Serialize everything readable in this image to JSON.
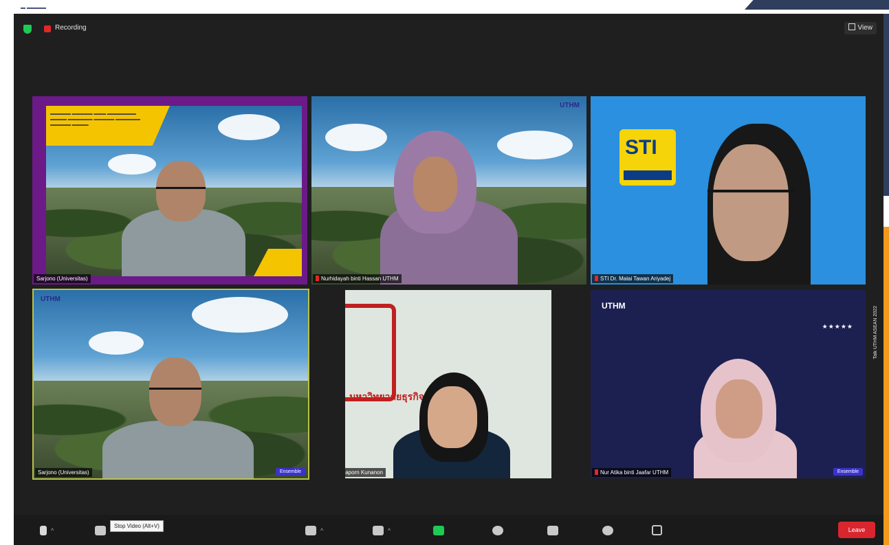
{
  "window": {
    "recording_label": "Recording",
    "view_label": "View"
  },
  "participants": [
    {
      "name": "Sarjono (Universitas)",
      "muted": false,
      "badge": ""
    },
    {
      "name": "Nurhidayah binti Hassan UTHM",
      "muted": true,
      "badge": ""
    },
    {
      "name": "STI Dr. Malai Tawan Ariyadej",
      "muted": true,
      "badge": ""
    },
    {
      "name": "Sarjono (Universitas)",
      "muted": false,
      "badge": "Ensemble"
    },
    {
      "name": "Thanaporn Kunanon",
      "muted": true,
      "badge": ""
    },
    {
      "name": "Nur Atika binti Jaafar UTHM",
      "muted": true,
      "badge": "Ensemble"
    }
  ],
  "tile_branding": {
    "sti_logo": "STI",
    "uthm_logo": "UTHM",
    "seal_text": "มหาวิทยาลัยธุรกิจบัณฑิตย์"
  },
  "toolbar": {
    "tooltip": "Stop Video (Alt+V)",
    "end_label": "Leave"
  },
  "side_caption": "Talk UTHM ASEAN 2022",
  "colors": {
    "zoom_bg": "#1f1f1f",
    "share_green": "#1ec954",
    "end_red": "#d9262e",
    "recording_red": "#e02828",
    "accent_orange": "#f39a1c",
    "accent_navy": "#2f3e5c"
  }
}
